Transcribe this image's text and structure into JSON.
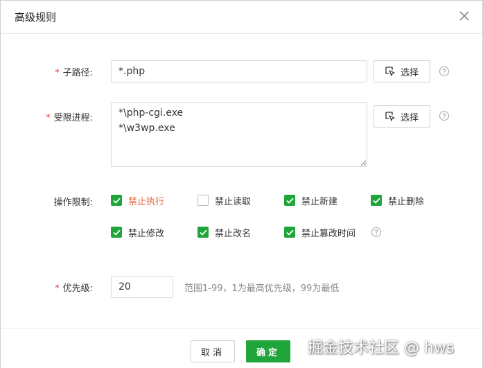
{
  "dialog": {
    "title": "高级规则"
  },
  "form": {
    "subpath": {
      "label": "子路径",
      "required_mark": "*",
      "colon": ":",
      "value": "*.php",
      "select_label": "选择"
    },
    "process": {
      "label": "受限进程",
      "required_mark": "*",
      "colon": ":",
      "value": "*\\php-cgi.exe\n*\\w3wp.exe",
      "select_label": "选择"
    },
    "operations": {
      "label": "操作限制",
      "colon": ":",
      "items": [
        {
          "label": "禁止执行",
          "checked": true,
          "highlight": true
        },
        {
          "label": "禁止读取",
          "checked": false
        },
        {
          "label": "禁止新建",
          "checked": true
        },
        {
          "label": "禁止删除",
          "checked": true
        },
        {
          "label": "禁止修改",
          "checked": true
        },
        {
          "label": "禁止改名",
          "checked": true
        },
        {
          "label": "禁止篡改时间",
          "checked": true
        }
      ]
    },
    "priority": {
      "label": "优先级",
      "required_mark": "*",
      "colon": ":",
      "value": "20",
      "hint": "范围1-99，1为最高优先级，99为最低"
    }
  },
  "footer": {
    "cancel_label": "取消",
    "ok_label": "确定"
  },
  "watermark": "掘金技术社区 @ hws",
  "colors": {
    "accent": "#20a53a",
    "required": "#e4393c",
    "highlight": "#e4663d"
  },
  "icons": {
    "close": "close-icon",
    "select": "cursor-select-icon",
    "help": "help-circle-icon",
    "check": "checkmark-icon"
  }
}
